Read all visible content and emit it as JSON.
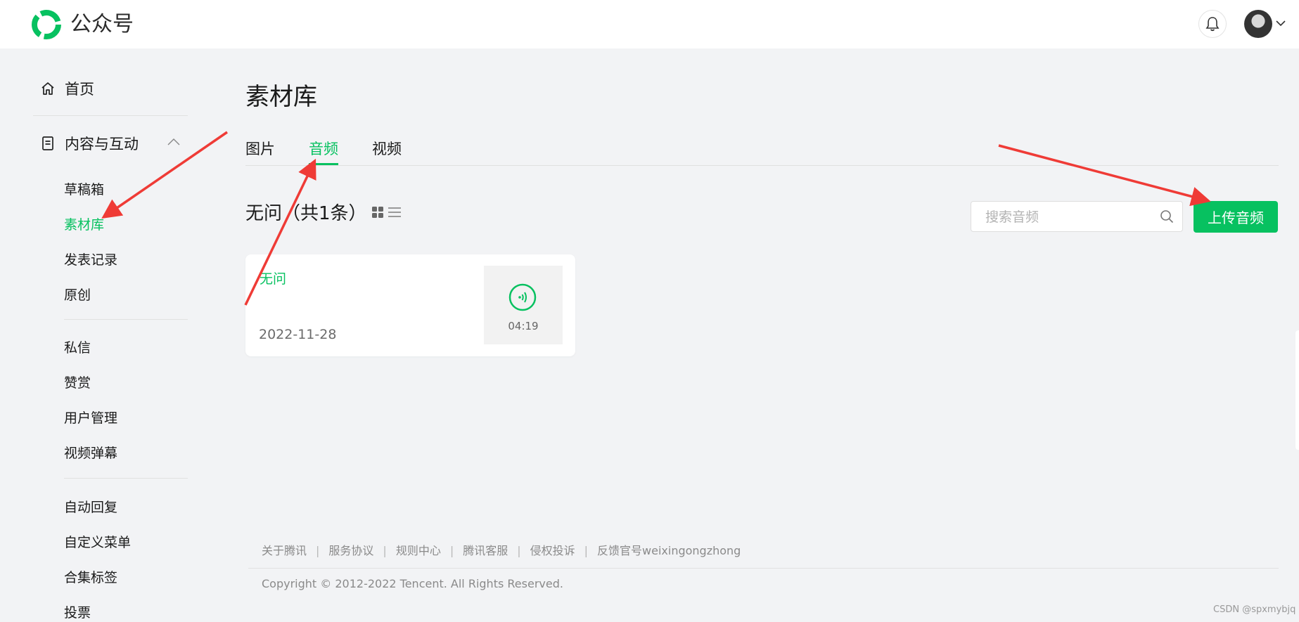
{
  "header": {
    "brand": "公众号",
    "icons": {
      "logo": "wechat-mp-logo-icon",
      "bell": "bell-icon",
      "caret": "chevron-down-icon"
    }
  },
  "sidebar": {
    "home": {
      "label": "首页",
      "icon": "home-icon"
    },
    "content_section": {
      "label": "内容与互动",
      "icon": "document-icon",
      "expanded": true
    },
    "content_items": [
      {
        "label": "草稿箱"
      },
      {
        "label": "素材库",
        "active": true
      },
      {
        "label": "发表记录"
      },
      {
        "label": "原创"
      }
    ],
    "interaction_items": [
      {
        "label": "私信"
      },
      {
        "label": "赞赏"
      },
      {
        "label": "用户管理"
      },
      {
        "label": "视频弹幕"
      }
    ],
    "feature_items": [
      {
        "label": "自动回复"
      },
      {
        "label": "自定义菜单"
      },
      {
        "label": "合集标签"
      },
      {
        "label": "投票"
      }
    ]
  },
  "main": {
    "title": "素材库",
    "tabs": [
      {
        "label": "图片"
      },
      {
        "label": "音频",
        "active": true
      },
      {
        "label": "视频"
      }
    ],
    "group_title": "无问",
    "group_count": "（共1条）",
    "view_icons": [
      "grid-view-icon",
      "list-view-icon"
    ],
    "search": {
      "placeholder": "搜索音频",
      "value": ""
    },
    "upload_label": "上传音频",
    "accent_color": "#07c160",
    "audio_items": [
      {
        "title": "无问",
        "date": "2022-11-28",
        "duration": "04:19",
        "icon": "audio-wave-icon"
      }
    ]
  },
  "footer": {
    "links": [
      {
        "label": "关于腾讯"
      },
      {
        "label": "服务协议"
      },
      {
        "label": "规则中心"
      },
      {
        "label": "腾讯客服"
      },
      {
        "label": "侵权投诉"
      },
      {
        "label": "反馈官号weixingongzhong"
      }
    ],
    "copyright": "Copyright © 2012-2022 Tencent. All Rights Reserved."
  },
  "watermark": "CSDN @spxmybjq",
  "annotation_color": "#ef3b36"
}
